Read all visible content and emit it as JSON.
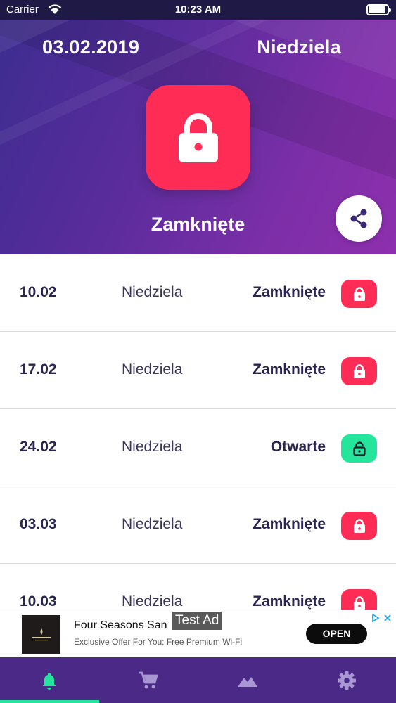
{
  "status_bar": {
    "carrier": "Carrier",
    "time": "10:23 AM"
  },
  "header": {
    "date": "03.02.2019",
    "day": "Niedziela",
    "status": "Zamknięte",
    "status_color": "#ff2d55"
  },
  "list": {
    "rows": [
      {
        "date": "10.02",
        "day": "Niedziela",
        "status": "Zamknięte",
        "state": "closed"
      },
      {
        "date": "17.02",
        "day": "Niedziela",
        "status": "Zamknięte",
        "state": "closed"
      },
      {
        "date": "24.02",
        "day": "Niedziela",
        "status": "Otwarte",
        "state": "open"
      },
      {
        "date": "03.03",
        "day": "Niedziela",
        "status": "Zamknięte",
        "state": "closed"
      },
      {
        "date": "10.03",
        "day": "Niedziela",
        "status": "Zamknięte",
        "state": "closed"
      }
    ],
    "closed_color": "#ff2d55",
    "open_color": "#24e59b"
  },
  "ad": {
    "label": "Test Ad",
    "title": "Four Seasons San",
    "subtitle": "Exclusive Offer For You: Free Premium Wi-Fi",
    "button": "OPEN"
  },
  "tabbar": {
    "tabs": [
      {
        "icon": "bell-icon",
        "active": true
      },
      {
        "icon": "cart-icon",
        "active": false
      },
      {
        "icon": "mountain-icon",
        "active": false
      },
      {
        "icon": "gear-icon",
        "active": false
      }
    ],
    "active_color": "#24e59b",
    "inactive_color": "#a997d4"
  }
}
